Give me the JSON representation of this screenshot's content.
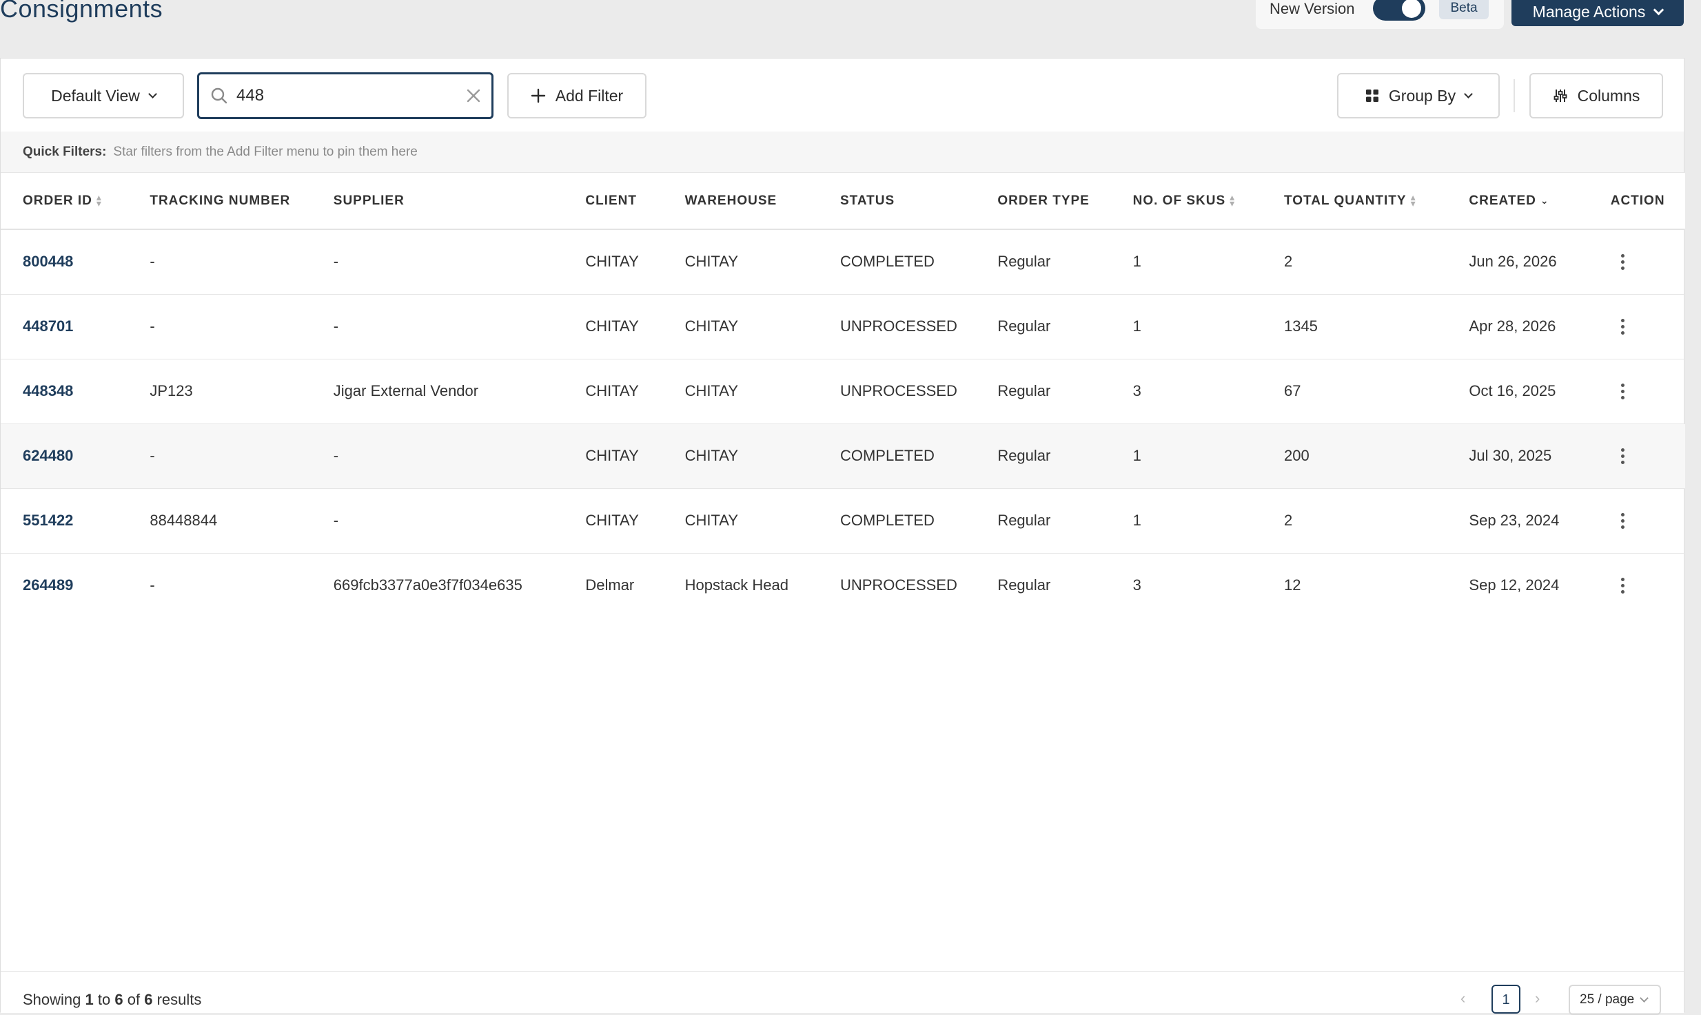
{
  "header": {
    "title": "Consignments",
    "new_version_label": "New Version",
    "beta_label": "Beta",
    "manage_actions_label": "Manage Actions"
  },
  "toolbar": {
    "view_label": "Default View",
    "search_value": "448",
    "add_filter_label": "Add Filter",
    "group_by_label": "Group By",
    "columns_label": "Columns"
  },
  "quick_filters": {
    "label": "Quick Filters:",
    "hint": "Star filters from the Add Filter menu to pin them here"
  },
  "table": {
    "columns": [
      "ORDER ID",
      "TRACKING NUMBER",
      "SUPPLIER",
      "CLIENT",
      "WAREHOUSE",
      "STATUS",
      "ORDER TYPE",
      "NO. OF SKUS",
      "TOTAL QUANTITY",
      "CREATED",
      "ACTION"
    ],
    "rows": [
      {
        "order_id": "800448",
        "tracking": "-",
        "supplier": "-",
        "client": "CHITAY",
        "warehouse": "CHITAY",
        "status": "COMPLETED",
        "order_type": "Regular",
        "skus": "1",
        "quantity": "2",
        "created": "Jun 26, 2026"
      },
      {
        "order_id": "448701",
        "tracking": "-",
        "supplier": "-",
        "client": "CHITAY",
        "warehouse": "CHITAY",
        "status": "UNPROCESSED",
        "order_type": "Regular",
        "skus": "1",
        "quantity": "1345",
        "created": "Apr 28, 2026"
      },
      {
        "order_id": "448348",
        "tracking": "JP123",
        "supplier": "Jigar External Vendor",
        "client": "CHITAY",
        "warehouse": "CHITAY",
        "status": "UNPROCESSED",
        "order_type": "Regular",
        "skus": "3",
        "quantity": "67",
        "created": "Oct 16, 2025"
      },
      {
        "order_id": "624480",
        "tracking": "-",
        "supplier": "-",
        "client": "CHITAY",
        "warehouse": "CHITAY",
        "status": "COMPLETED",
        "order_type": "Regular",
        "skus": "1",
        "quantity": "200",
        "created": "Jul 30, 2025"
      },
      {
        "order_id": "551422",
        "tracking": "88448844",
        "supplier": "-",
        "client": "CHITAY",
        "warehouse": "CHITAY",
        "status": "COMPLETED",
        "order_type": "Regular",
        "skus": "1",
        "quantity": "2",
        "created": "Sep 23, 2024"
      },
      {
        "order_id": "264489",
        "tracking": "-",
        "supplier": "669fcb3377a0e3f7f034e635",
        "client": "Delmar",
        "warehouse": "Hopstack Head",
        "status": "UNPROCESSED",
        "order_type": "Regular",
        "skus": "3",
        "quantity": "12",
        "created": "Sep 12, 2024"
      }
    ]
  },
  "footer": {
    "showing": "Showing",
    "from": "1",
    "to_word": "to",
    "to": "6",
    "of_word": "of",
    "total": "6",
    "results_word": "results",
    "current_page": "1",
    "page_size": "25 / page"
  },
  "colors": {
    "brand": "#1f3d5c",
    "background": "#ebebeb"
  }
}
